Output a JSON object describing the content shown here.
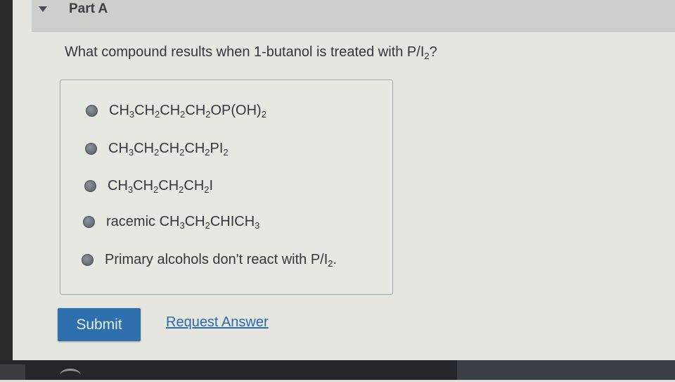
{
  "part": {
    "title": "Part A"
  },
  "question": {
    "prefix": "What compound results when 1-butanol is treated with P/I",
    "sub": "2",
    "suffix": "?"
  },
  "choices": [
    {
      "parts": [
        [
          "CH",
          ""
        ],
        [
          "3",
          "s"
        ],
        [
          "CH",
          ""
        ],
        [
          "2",
          "s"
        ],
        [
          "CH",
          ""
        ],
        [
          "2",
          "s"
        ],
        [
          "CH",
          ""
        ],
        [
          "2",
          "s"
        ],
        [
          "OP(OH)",
          ""
        ],
        [
          "2",
          "s"
        ]
      ]
    },
    {
      "parts": [
        [
          "CH",
          ""
        ],
        [
          "3",
          "s"
        ],
        [
          "CH",
          ""
        ],
        [
          "2",
          "s"
        ],
        [
          "CH",
          ""
        ],
        [
          "2",
          "s"
        ],
        [
          "CH",
          ""
        ],
        [
          "2",
          "s"
        ],
        [
          "PI",
          ""
        ],
        [
          "2",
          "s"
        ]
      ]
    },
    {
      "parts": [
        [
          "CH",
          ""
        ],
        [
          "3",
          "s"
        ],
        [
          "CH",
          ""
        ],
        [
          "2",
          "s"
        ],
        [
          "CH",
          ""
        ],
        [
          "2",
          "s"
        ],
        [
          "CH",
          ""
        ],
        [
          "2",
          "s"
        ],
        [
          "I",
          ""
        ]
      ]
    },
    {
      "parts": [
        [
          "racemic CH",
          ""
        ],
        [
          "3",
          "s"
        ],
        [
          "CH",
          ""
        ],
        [
          "2",
          "s"
        ],
        [
          "CHICH",
          ""
        ],
        [
          "3",
          "s"
        ]
      ]
    },
    {
      "parts": [
        [
          "Primary alcohols don't react with P/I",
          ""
        ],
        [
          "2",
          "s"
        ],
        [
          ".",
          ""
        ]
      ]
    }
  ],
  "actions": {
    "submit_label": "Submit",
    "request_label": "Request Answer"
  },
  "colors": {
    "submit_bg": "#2e6fae",
    "link": "#2c6aa8"
  }
}
